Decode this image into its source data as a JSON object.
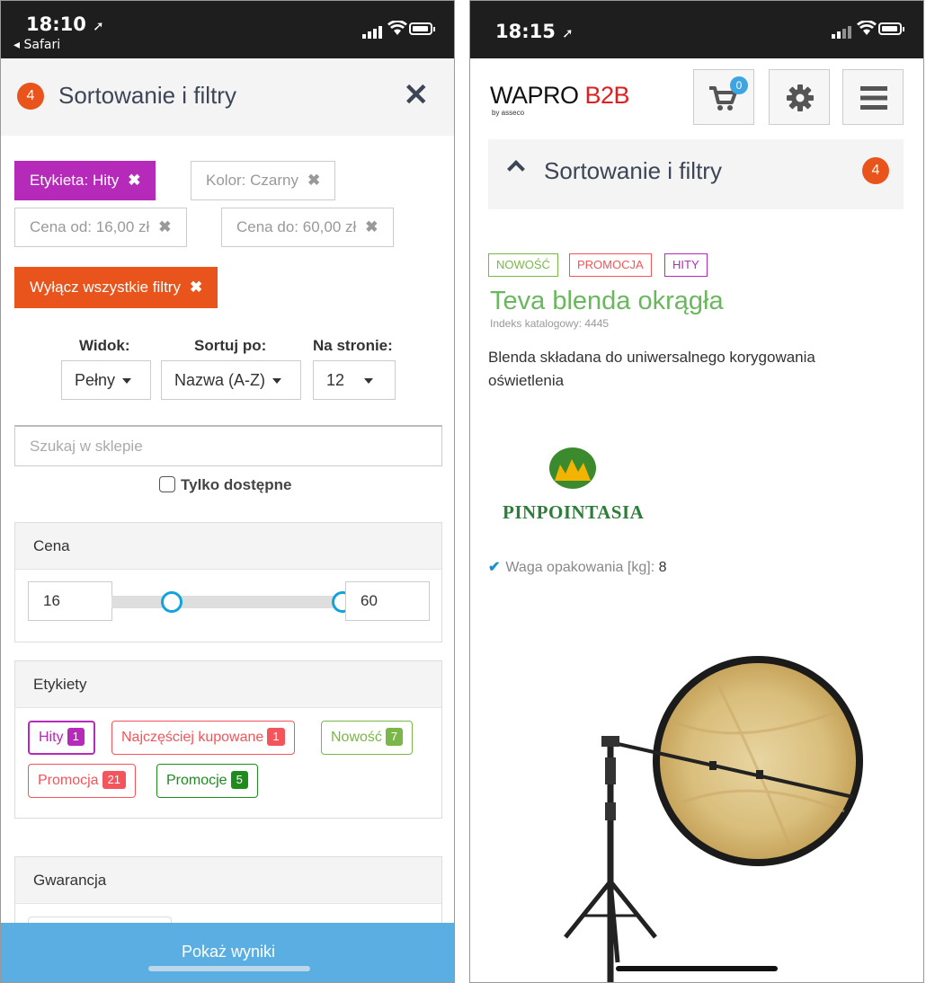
{
  "left": {
    "status": {
      "time": "18:10",
      "back_label": "◂ Safari"
    },
    "header": {
      "badge": "4",
      "title": "Sortowanie i filtry",
      "close_icon": "close-icon"
    },
    "active_filters": [
      {
        "key": "Etykieta:",
        "value": "Hity"
      },
      {
        "key": "Kolor:",
        "value": "Czarny"
      },
      {
        "key": "Cena od:",
        "value": "16,00 zł"
      },
      {
        "key": "Cena do:",
        "value": "60,00 zł"
      }
    ],
    "clear_all": "Wyłącz wszystkie filtry",
    "view": {
      "label": "Widok:",
      "value": "Pełny"
    },
    "sort": {
      "label": "Sortuj po:",
      "value": "Nazwa (A-Z)"
    },
    "per_page": {
      "label": "Na stronie:",
      "value": "12"
    },
    "search": {
      "placeholder": "Szukaj w sklepie"
    },
    "only_available": "Tylko dostępne",
    "price": {
      "title": "Cena",
      "min": "16",
      "max": "60"
    },
    "labels": {
      "title": "Etykiety",
      "items": [
        {
          "name": "Hity",
          "count": "1",
          "color": "#b62ab9"
        },
        {
          "name": "Najczęściej kupowane",
          "count": "1",
          "color": "#f4545c"
        },
        {
          "name": "Nowość",
          "count": "7",
          "color": "#7ab648"
        },
        {
          "name": "Promocja",
          "count": "21",
          "color": "#f4545c"
        },
        {
          "name": "Promocje",
          "count": "5",
          "color": "#1e8b1e"
        }
      ]
    },
    "guarantee": {
      "title": "Gwarancja"
    },
    "show_results": "Pokaż wyniki"
  },
  "right": {
    "status": {
      "time": "18:15"
    },
    "logo": {
      "main": "WAPRO ",
      "accent": "B2B",
      "sub": "by asseco"
    },
    "cart_count": "0",
    "sort_panel": {
      "title": "Sortowanie i filtry",
      "badge": "4"
    },
    "product": {
      "tags": [
        {
          "label": "NOWOŚĆ",
          "color": "#7ab648"
        },
        {
          "label": "PROMOCJA",
          "color": "#f4545c"
        },
        {
          "label": "HITY",
          "color": "#b62ab9"
        }
      ],
      "title": "Teva blenda okrągła",
      "index_label": "Indeks katalogowy: 4445",
      "description": "Blenda składana do uniwersalnego korygowania oświetlenia",
      "brand": "PINPOINTASIA",
      "weight_label": "Waga opakowania [kg]:",
      "weight_value": "8"
    }
  }
}
